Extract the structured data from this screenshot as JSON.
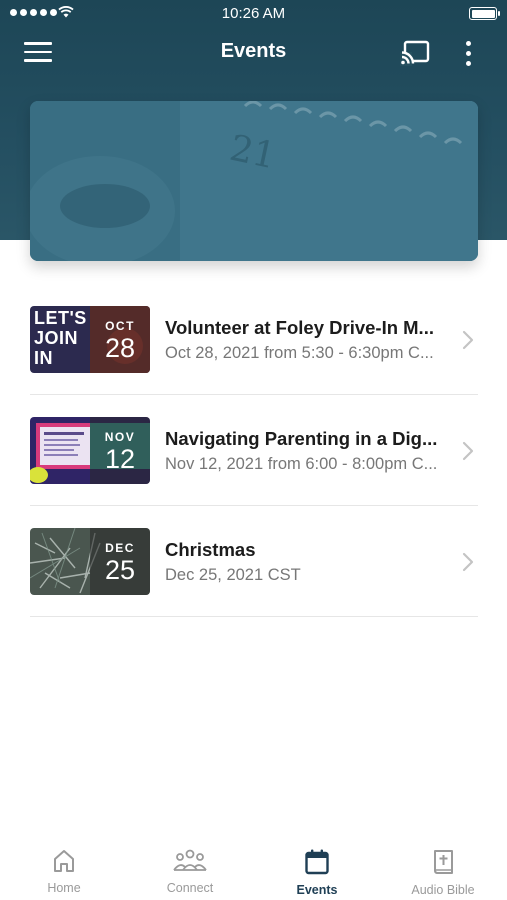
{
  "status_bar": {
    "time": "10:26 AM"
  },
  "header": {
    "title": "Events",
    "icons": [
      "menu-icon",
      "cast-icon",
      "more-vertical-icon"
    ]
  },
  "colors": {
    "header_bg": "#1d4656",
    "accent": "#1f3f55",
    "muted_text": "#777777"
  },
  "events": [
    {
      "title": "Volunteer at Foley Drive-In M...",
      "subtitle": "Oct 28, 2021 from 5:30 - 6:30pm C...",
      "month": "OCT",
      "day": "28",
      "thumb_text": "LET'S JOIN IN"
    },
    {
      "title": "Navigating Parenting in a Dig...",
      "subtitle": "Nov 12, 2021 from 6:00 - 8:00pm C...",
      "month": "NOV",
      "day": "12"
    },
    {
      "title": "Christmas",
      "subtitle": "Dec 25, 2021 CST",
      "month": "DEC",
      "day": "25"
    }
  ],
  "tabs": [
    {
      "label": "Home",
      "icon": "home-icon"
    },
    {
      "label": "Connect",
      "icon": "people-icon"
    },
    {
      "label": "Events",
      "icon": "calendar-icon",
      "active": true
    },
    {
      "label": "Audio Bible",
      "icon": "bible-icon"
    }
  ]
}
